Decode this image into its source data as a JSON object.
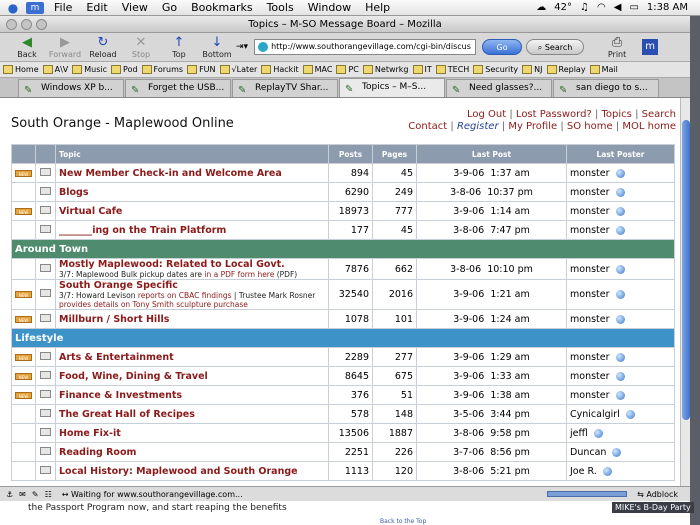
{
  "menubar": {
    "items": [
      "File",
      "Edit",
      "View",
      "Go",
      "Bookmarks",
      "Tools",
      "Window",
      "Help"
    ],
    "temp": "42°",
    "clock": "1:38 AM"
  },
  "window": {
    "title": "Topics – M-SO Message Board – Mozilla"
  },
  "toolbar": {
    "back": "Back",
    "forward": "Forward",
    "reload": "Reload",
    "stop": "Stop",
    "top": "Top",
    "bottom": "Bottom",
    "url": "http://www.southorangevillage.com/cgi-bin/discus",
    "go": "Go",
    "search": "Search",
    "print": "Print"
  },
  "bookmarks": [
    "Home",
    "A\\V",
    "Music",
    "Pod",
    "Forums",
    "FUN",
    "√Later",
    "Hackit",
    "MAC",
    "PC",
    "Netwrkg",
    "IT",
    "TECH",
    "Security",
    "NJ",
    "Replay",
    "Mail"
  ],
  "tabs": [
    "Windows XP b...",
    "Forget the USB...",
    "ReplayTV Shar...",
    "Topics – M–S...",
    "Need glasses?...",
    "san diego to s..."
  ],
  "site": {
    "title": "South Orange - Maplewood Online",
    "links_row1": [
      "Log Out",
      "Lost Password?",
      "Topics",
      "Search"
    ],
    "links_row2": [
      "Contact",
      "Register",
      "My Profile",
      "SO home",
      "MOL home"
    ]
  },
  "table": {
    "headers": {
      "topic": "Topic",
      "posts": "Posts",
      "pages": "Pages",
      "last_post": "Last Post",
      "last_poster": "Last Poster"
    },
    "rows": [
      {
        "name": "New Member Check-in and Welcome Area",
        "posts": "894",
        "pages": "45",
        "date": "3-9-06",
        "time": "1:37 am",
        "poster": "monster"
      },
      {
        "name": "Blogs",
        "posts": "6290",
        "pages": "249",
        "date": "3-8-06",
        "time": "10:37 pm",
        "poster": "monster"
      },
      {
        "name": "Virtual Cafe",
        "posts": "18973",
        "pages": "777",
        "date": "3-9-06",
        "time": "1:14 am",
        "poster": "monster"
      },
      {
        "name": "_______ing on the Train Platform",
        "posts": "177",
        "pages": "45",
        "date": "3-8-06",
        "time": "7:47 pm",
        "poster": "monster"
      }
    ],
    "section1": "Around Town",
    "rows2": [
      {
        "name": "Mostly Maplewood: Related to Local Govt.",
        "desc_a": "3/7: Maplewood Bulk pickup dates are ",
        "desc_link": "in a PDF form here",
        "desc_b": " (PDF)",
        "posts": "7876",
        "pages": "662",
        "date": "3-8-06",
        "time": "10:10 pm",
        "poster": "monster"
      },
      {
        "name": "South Orange Specific",
        "desc_a": "3/7: Howard Levison ",
        "desc_link": "reports on CBAC findings",
        "desc_b": " | Trustee Mark Rosner ",
        "desc_link2": "provides details on Tony Smith sculpture purchase",
        "posts": "32540",
        "pages": "2016",
        "date": "3-9-06",
        "time": "1:21 am",
        "poster": "monster"
      },
      {
        "name": "Millburn / Short Hills",
        "posts": "1078",
        "pages": "101",
        "date": "3-9-06",
        "time": "1:24 am",
        "poster": "monster"
      }
    ],
    "section2": "Lifestyle",
    "rows3": [
      {
        "name": "Arts & Entertainment",
        "posts": "2289",
        "pages": "277",
        "date": "3-9-06",
        "time": "1:29 am",
        "poster": "monster"
      },
      {
        "name": "Food, Wine, Dining & Travel",
        "posts": "8645",
        "pages": "675",
        "date": "3-9-06",
        "time": "1:33 am",
        "poster": "monster"
      },
      {
        "name": "Finance & Investments",
        "posts": "376",
        "pages": "51",
        "date": "3-9-06",
        "time": "1:38 am",
        "poster": "monster"
      },
      {
        "name": "The Great Hall of Recipes",
        "posts": "578",
        "pages": "148",
        "date": "3-5-06",
        "time": "3:44 pm",
        "poster": "Cynicalgirl"
      },
      {
        "name": "Home Fix-it",
        "posts": "13506",
        "pages": "1887",
        "date": "3-8-06",
        "time": "9:58 pm",
        "poster": "jeffl"
      },
      {
        "name": "Reading Room",
        "posts": "2251",
        "pages": "226",
        "date": "3-7-06",
        "time": "8:56 pm",
        "poster": "Duncan"
      },
      {
        "name": "Local History: Maplewood and South Orange",
        "posts": "1113",
        "pages": "120",
        "date": "3-8-06",
        "time": "5:21 pm",
        "poster": "Joe R."
      }
    ]
  },
  "status": {
    "text": "Waiting for www.southorangevillage.com...",
    "adblock": "Adblock"
  },
  "desktop": {
    "text": "the Passport Program now, and start reaping the benefits",
    "back_to_top": "Back to the Top",
    "mikes": "MIKE's B-Day Party"
  }
}
